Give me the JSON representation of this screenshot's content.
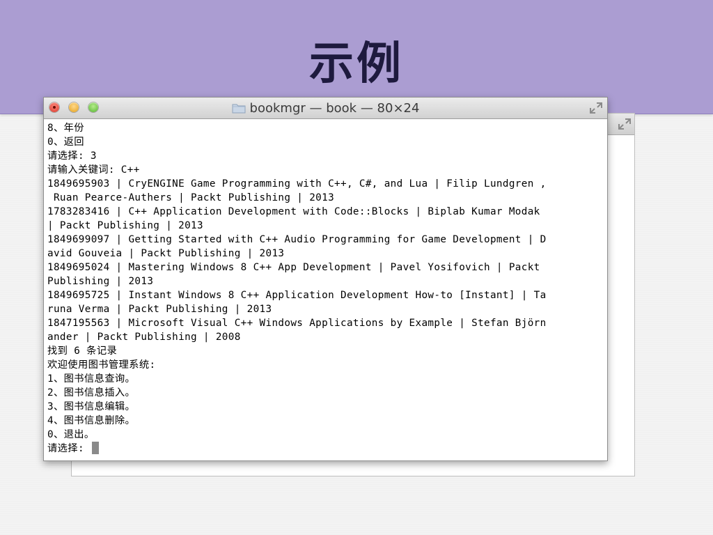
{
  "slide": {
    "title": "示例"
  },
  "terminal": {
    "window_title": "bookmgr — book — 80×24",
    "lines": [
      "8、年份",
      "0、返回",
      "请选择: 3",
      "请输入关键词: C++",
      "1849695903 | CryENGINE Game Programming with C++, C#, and Lua | Filip Lundgren ,",
      " Ruan Pearce-Authers | Packt Publishing | 2013",
      "1783283416 | C++ Application Development with Code::Blocks | Biplab Kumar Modak",
      "| Packt Publishing | 2013",
      "1849699097 | Getting Started with C++ Audio Programming for Game Development | D",
      "avid Gouveia | Packt Publishing | 2013",
      "1849695024 | Mastering Windows 8 C++ App Development | Pavel Yosifovich | Packt",
      "Publishing | 2013",
      "1849695725 | Instant Windows 8 C++ Application Development How-to [Instant] | Ta",
      "runa Verma | Packt Publishing | 2013",
      "1847195563 | Microsoft Visual C++ Windows Applications by Example | Stefan Björn",
      "ander | Packt Publishing | 2008",
      "找到 6 条记录",
      "欢迎使用图书管理系统:",
      "1、图书信息查询。",
      "2、图书信息插入。",
      "3、图书信息编辑。",
      "4、图书信息删除。",
      "0、退出。",
      "请选择: "
    ]
  },
  "icons": {
    "close": "close-icon",
    "minimize": "minimize-icon",
    "zoom": "zoom-icon",
    "folder": "folder-icon",
    "fullscreen": "fullscreen-icon"
  },
  "colors": {
    "header_band": "#ab9dd2",
    "title_text": "#1e1a3e",
    "close": "#d6362a",
    "minimize": "#e3a11c",
    "zoom": "#55b530"
  }
}
